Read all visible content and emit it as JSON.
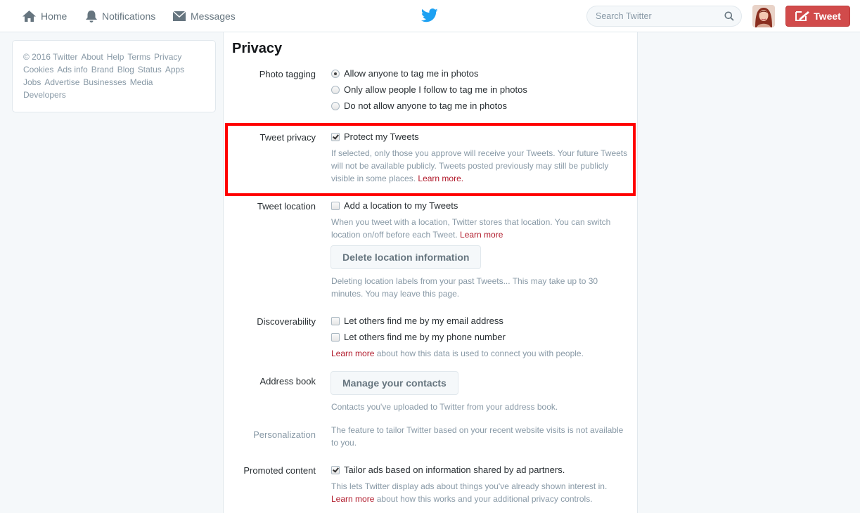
{
  "nav": {
    "home": "Home",
    "notifications": "Notifications",
    "messages": "Messages",
    "search_placeholder": "Search Twitter",
    "tweet_button": "Tweet"
  },
  "footer_links": [
    "© 2016 Twitter",
    "About",
    "Help",
    "Terms",
    "Privacy",
    "Cookies",
    "Ads info",
    "Brand",
    "Blog",
    "Status",
    "Apps",
    "Jobs",
    "Advertise",
    "Businesses",
    "Media",
    "Developers"
  ],
  "page": {
    "title": "Privacy",
    "photo_tagging": {
      "label": "Photo tagging",
      "options": [
        "Allow anyone to tag me in photos",
        "Only allow people I follow to tag me in photos",
        "Do not allow anyone to tag me in photos"
      ],
      "selected_index": 0
    },
    "tweet_privacy": {
      "label": "Tweet privacy",
      "checkbox": "Protect my Tweets",
      "checked": true,
      "help": "If selected, only those you approve will receive your Tweets. Your future Tweets will not be available publicly. Tweets posted previously may still be publicly visible in some places.",
      "learn_more": "Learn more."
    },
    "tweet_location": {
      "label": "Tweet location",
      "checkbox": "Add a location to my Tweets",
      "checked": false,
      "help": "When you tweet with a location, Twitter stores that location. You can switch location on/off before each Tweet.",
      "learn_more": "Learn more",
      "button": "Delete location information",
      "button_help": "Deleting location labels from your past Tweets... This may take up to 30 minutes. You may leave this page."
    },
    "discoverability": {
      "label": "Discoverability",
      "email_checkbox": "Let others find me by my email address",
      "phone_checkbox": "Let others find me by my phone number",
      "learn_more": "Learn more",
      "help": "about how this data is used to connect you with people."
    },
    "address_book": {
      "label": "Address book",
      "button": "Manage your contacts",
      "help": "Contacts you've uploaded to Twitter from your address book."
    },
    "personalization": {
      "label": "Personalization",
      "help": "The feature to tailor Twitter based on your recent website visits is not available to you."
    },
    "promoted_content": {
      "label": "Promoted content",
      "checkbox": "Tailor ads based on information shared by ad partners.",
      "checked": true,
      "help": "This lets Twitter display ads about things you've already shown interest in.",
      "learn_more": "Learn more",
      "help2": "about how this works and your additional privacy controls."
    }
  },
  "colors": {
    "accent": "#d14b4b",
    "link": "#b0192a",
    "twitter_blue": "#1da1f2",
    "highlight": "#ff0000"
  }
}
